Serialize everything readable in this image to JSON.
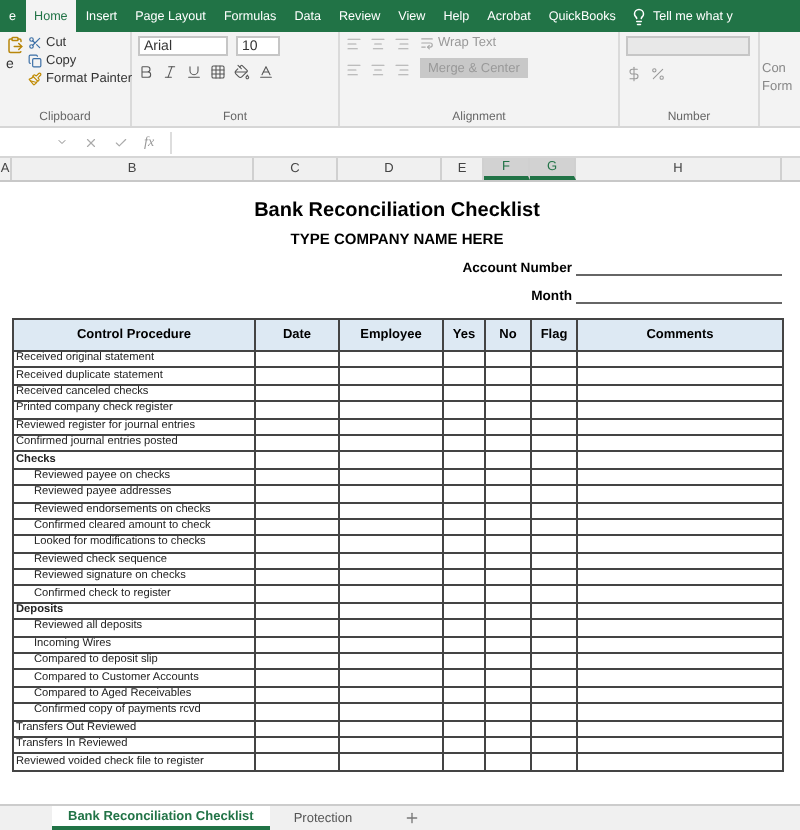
{
  "ribbon": {
    "tabs": [
      {
        "label": "e",
        "selected": false
      },
      {
        "label": "Home",
        "selected": true
      },
      {
        "label": "Insert",
        "selected": false
      },
      {
        "label": "Page Layout",
        "selected": false
      },
      {
        "label": "Formulas",
        "selected": false
      },
      {
        "label": "Data",
        "selected": false
      },
      {
        "label": "Review",
        "selected": false
      },
      {
        "label": "View",
        "selected": false
      },
      {
        "label": "Help",
        "selected": false
      },
      {
        "label": "Acrobat",
        "selected": false
      },
      {
        "label": "QuickBooks",
        "selected": false
      }
    ],
    "tell_me": "Tell me what y",
    "clipboard": {
      "paste_label": "e",
      "cut": "Cut",
      "copy": "Copy",
      "format_painter": "Format Painter",
      "group": "Clipboard"
    },
    "font": {
      "name": "Arial",
      "size": "10",
      "group": "Font"
    },
    "alignment": {
      "wrap": "Wrap Text",
      "merge": "Merge & Center",
      "group": "Alignment"
    },
    "number": {
      "group": "Number"
    },
    "styles_cut": [
      "Con",
      "Form"
    ]
  },
  "formula_bar": {
    "fx": "fx"
  },
  "column_headers": [
    {
      "label": "A",
      "selected": false
    },
    {
      "label": "B",
      "selected": false
    },
    {
      "label": "C",
      "selected": false
    },
    {
      "label": "D",
      "selected": false
    },
    {
      "label": "E",
      "selected": false
    },
    {
      "label": "F",
      "selected": true
    },
    {
      "label": "G",
      "selected": true
    },
    {
      "label": "H",
      "selected": false
    }
  ],
  "sheet": {
    "title": "Bank Reconciliation Checklist",
    "company": "TYPE COMPANY NAME HERE",
    "fields": [
      {
        "label": "Account Number"
      },
      {
        "label": "Month"
      }
    ],
    "columns": [
      "Control Procedure",
      "Date",
      "Employee",
      "Yes",
      "No",
      "Flag",
      "Comments"
    ],
    "rows": [
      {
        "text": "Received original statement",
        "kind": "item"
      },
      {
        "text": "Received duplicate statement",
        "kind": "item"
      },
      {
        "text": "Received canceled checks",
        "kind": "item"
      },
      {
        "text": "Printed company check register",
        "kind": "item"
      },
      {
        "text": "Reviewed register for journal entries",
        "kind": "item"
      },
      {
        "text": "Confirmed journal entries posted",
        "kind": "item"
      },
      {
        "text": "Checks",
        "kind": "section"
      },
      {
        "text": "Reviewed payee on checks",
        "kind": "sub"
      },
      {
        "text": "Reviewed payee addresses",
        "kind": "sub"
      },
      {
        "text": "Reviewed endorsements on checks",
        "kind": "sub"
      },
      {
        "text": "Confirmed cleared amount to check",
        "kind": "sub"
      },
      {
        "text": "Looked for modifications to checks",
        "kind": "sub"
      },
      {
        "text": "Reviewed check sequence",
        "kind": "sub"
      },
      {
        "text": "Reviewed signature on checks",
        "kind": "sub"
      },
      {
        "text": "Confirmed check to register",
        "kind": "sub"
      },
      {
        "text": "Deposits",
        "kind": "section"
      },
      {
        "text": "Reviewed all deposits",
        "kind": "sub"
      },
      {
        "text": "Incoming Wires",
        "kind": "sub"
      },
      {
        "text": "Compared to deposit slip",
        "kind": "sub"
      },
      {
        "text": "Compared to Customer Accounts",
        "kind": "sub"
      },
      {
        "text": "Compared to Aged Receivables",
        "kind": "sub"
      },
      {
        "text": "Confirmed copy of payments rcvd",
        "kind": "sub"
      },
      {
        "text": "Transfers Out Reviewed",
        "kind": "item"
      },
      {
        "text": "Transfers In Reviewed",
        "kind": "item"
      },
      {
        "text": "Reviewed voided check file to register",
        "kind": "item"
      }
    ]
  },
  "sheet_tabs": [
    {
      "label": "Bank Reconciliation Checklist",
      "selected": true
    },
    {
      "label": "Protection",
      "selected": false
    }
  ]
}
